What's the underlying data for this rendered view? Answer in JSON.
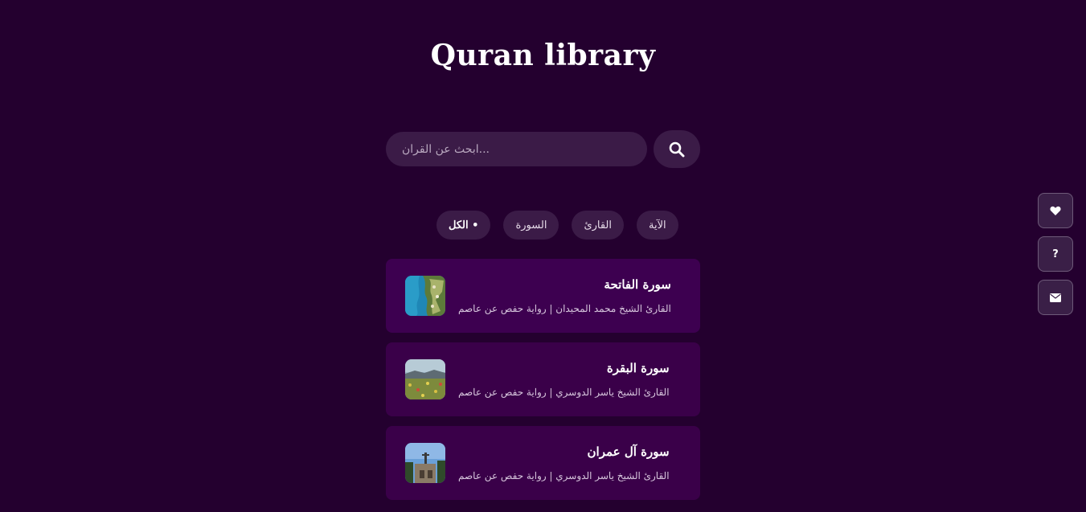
{
  "header": {
    "title": "Quran library"
  },
  "search": {
    "placeholder": "...ابحث عن القران",
    "icon": "search-icon"
  },
  "filters": [
    {
      "label": "الكل •",
      "active": true
    },
    {
      "label": "السورة",
      "active": false
    },
    {
      "label": "القارئ",
      "active": false
    },
    {
      "label": "الآية",
      "active": false
    }
  ],
  "cards": [
    {
      "title": "سورة الفاتحة",
      "subtitle": "القارئ الشيخ محمد المحيدان | رواية حفص عن عاصم",
      "thumbnail": "coastline-aerial-photo"
    },
    {
      "title": "سورة البقرة",
      "subtitle": "القارئ الشيخ ياسر الدوسري | رواية حفص عن عاصم",
      "thumbnail": "flower-field-photo"
    },
    {
      "title": "سورة آل عمران",
      "subtitle": "القارئ الشيخ ياسر الدوسري | رواية حفص عن عاصم",
      "thumbnail": "stone-building-photo"
    }
  ],
  "side_actions": [
    {
      "icon": "heart-icon"
    },
    {
      "icon": "question-icon",
      "glyph": "?"
    },
    {
      "icon": "envelope-icon"
    }
  ],
  "colors": {
    "background": "#24002f",
    "card": "#3d0050",
    "chip": "#3b1b47"
  }
}
